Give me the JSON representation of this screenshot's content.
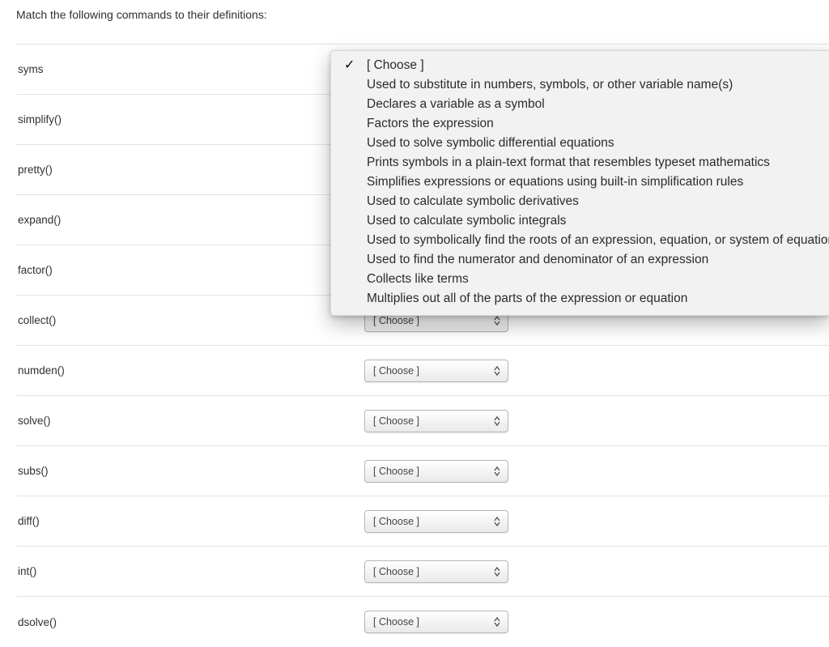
{
  "question": "Match the following commands to their definitions:",
  "choose_placeholder": "[ Choose ]",
  "rows": [
    {
      "term": "syms"
    },
    {
      "term": "simplify()"
    },
    {
      "term": "pretty()"
    },
    {
      "term": "expand()"
    },
    {
      "term": "factor()"
    },
    {
      "term": "collect()"
    },
    {
      "term": "numden()"
    },
    {
      "term": "solve()"
    },
    {
      "term": "subs()"
    },
    {
      "term": "diff()"
    },
    {
      "term": "int()"
    },
    {
      "term": "dsolve()"
    }
  ],
  "dropdown": {
    "selected": "[ Choose ]",
    "options": [
      "[ Choose ]",
      "Used to substitute in numbers, symbols, or other variable name(s)",
      "Declares a variable as a symbol",
      "Factors the expression",
      "Used to solve symbolic differential equations",
      "Prints symbols in a plain-text format that resembles typeset mathematics",
      "Simplifies expressions or equations using built-in simplification rules",
      "Used to calculate symbolic derivatives",
      "Used to calculate symbolic integrals",
      "Used to symbolically find the roots of an expression, equation, or system of equations",
      "Used to find the numerator and denominator of an expression",
      "Collects like terms",
      "Multiplies out all of the parts of the expression or equation"
    ]
  }
}
